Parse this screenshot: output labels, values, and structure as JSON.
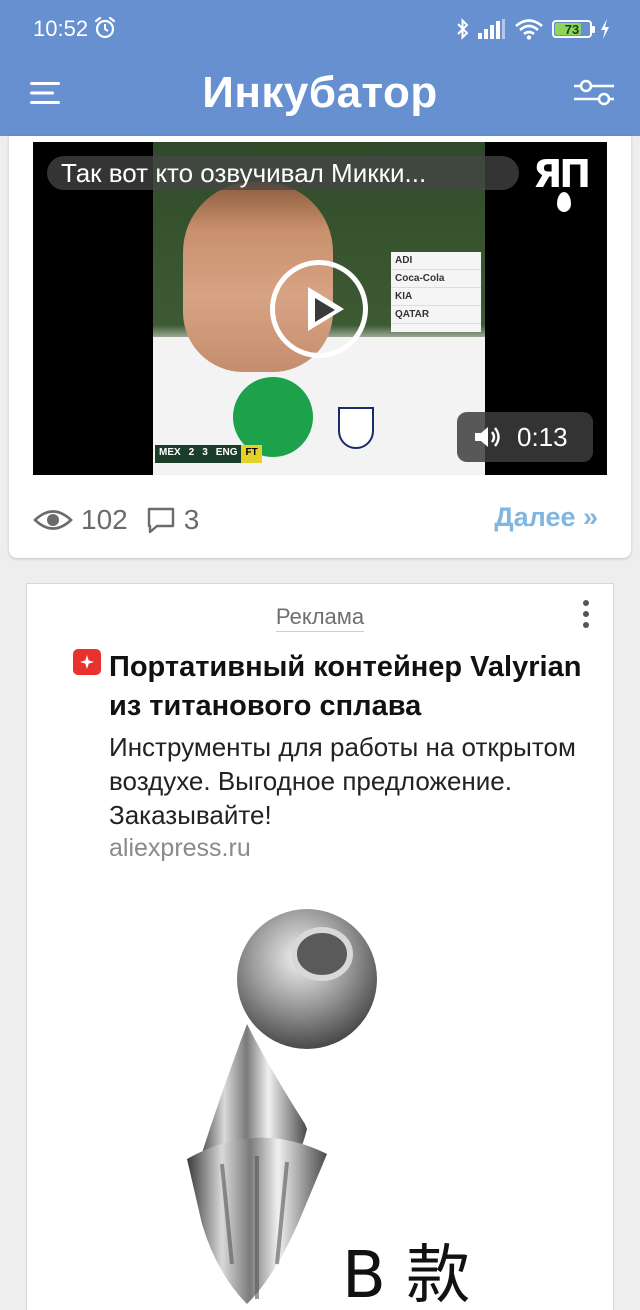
{
  "status_bar": {
    "time": "10:52",
    "battery": "73"
  },
  "app_bar": {
    "title": "Инкубатор"
  },
  "post": {
    "video": {
      "title": "Так вот кто озвучивал Микки...",
      "duration": "0:13",
      "channel_logo": "ЯП",
      "board_texts": [
        "ADI",
        "Coca-Cola",
        "KIA",
        "QATAR"
      ],
      "scoreboard": [
        "MEX",
        "2",
        "3",
        "ENG",
        "FT"
      ]
    },
    "views": "102",
    "comments": "3",
    "more_label": "Далее »"
  },
  "ad": {
    "label": "Реклама",
    "title": "Портативный контейнер Valyrian из титанового сплава",
    "text": "Инструменты для работы на открытом воздухе. Выгодное предложение. Заказывайте!",
    "domain": "aliexpress.ru",
    "image_caption": "B 款"
  },
  "colors": {
    "header_bg": "#6690cf",
    "link": "#7fb6e2",
    "ad_badge": "#e8322f"
  }
}
